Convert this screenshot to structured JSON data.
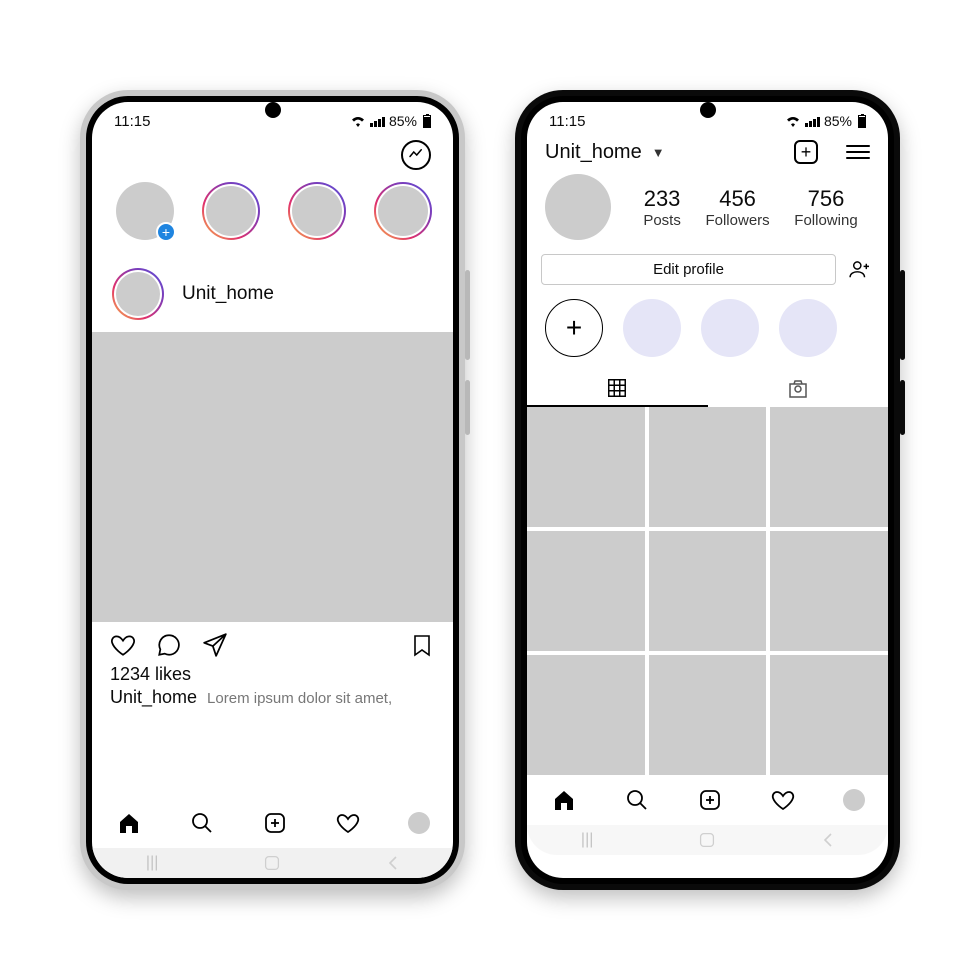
{
  "status": {
    "time": "11:15",
    "battery": "85%"
  },
  "feed": {
    "username_header": "Unit_home",
    "likes": "1234 likes",
    "caption_user": "Unit_home",
    "caption_text": "Lorem ipsum dolor sit amet,"
  },
  "profile": {
    "username": "Unit_home",
    "stats": {
      "posts_n": "233",
      "posts_l": "Posts",
      "foll_n": "456",
      "foll_l": "Followers",
      "fng_n": "756",
      "fng_l": "Following"
    },
    "edit_label": "Edit profile"
  }
}
